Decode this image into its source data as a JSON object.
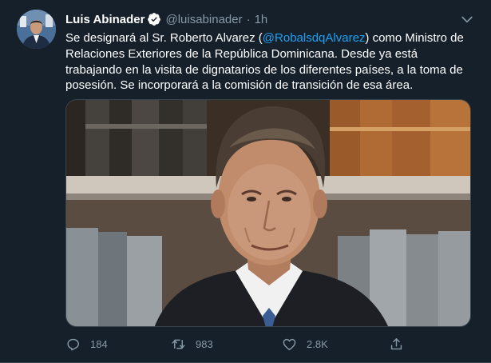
{
  "tweet": {
    "author_name": "Luis Abinader",
    "handle": "@luisabinader",
    "separator": "·",
    "time": "1h",
    "text_part1": "Se designará al Sr. Roberto Alvarez (",
    "mention": "@RobalsdqAlvarez",
    "text_part2": ") como Ministro de Relaciones Exteriores de la República Dominicana. Desde ya está trabajando en la visita de dignatarios de los diferentes países, a la toma de posesión. Se incorporará a la comisión de transición de esa área."
  },
  "actions": {
    "reply_count": "184",
    "retweet_count": "983",
    "like_count": "2.8K"
  },
  "icons": {
    "verified": "verified-badge-icon",
    "caret": "chevron-down-icon",
    "reply": "reply-icon",
    "retweet": "retweet-icon",
    "like": "heart-icon",
    "share": "share-icon"
  },
  "colors": {
    "background": "#15202b",
    "accent": "#1da1f2",
    "secondary_text": "#8899a6",
    "border": "#38444d"
  }
}
